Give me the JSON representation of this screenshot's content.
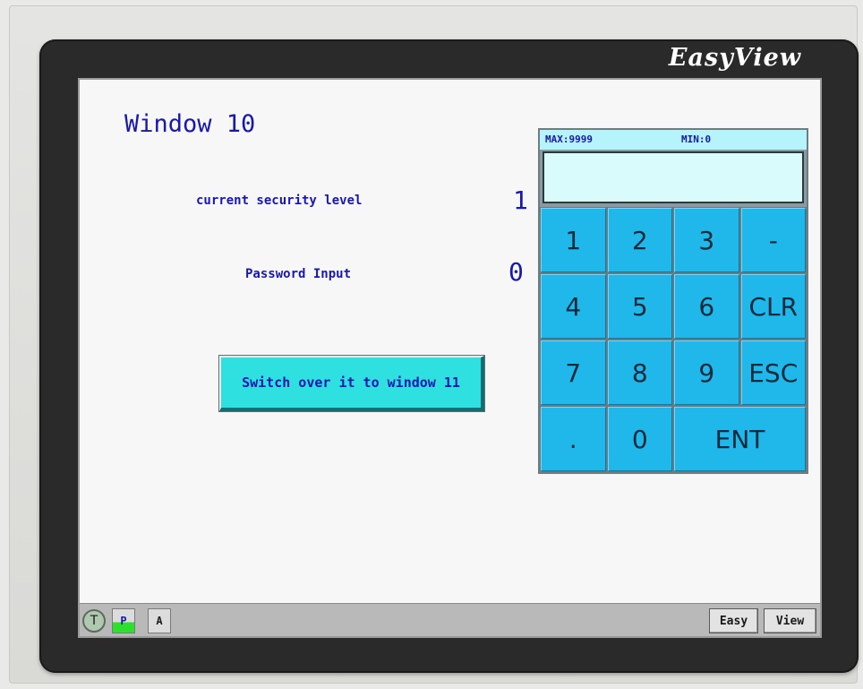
{
  "device": {
    "brand": "EasyView"
  },
  "screen": {
    "window_title": "Window 10",
    "security_label": "current security level",
    "security_value": "1",
    "password_label": "Password Input",
    "password_value": "0",
    "switch_button": "Switch over it to window 11"
  },
  "keypad": {
    "max_label": "MAX:9999",
    "min_label": "MIN:0",
    "display_value": "",
    "keys": [
      "1",
      "2",
      "3",
      "-",
      "4",
      "5",
      "6",
      "CLR",
      "7",
      "8",
      "9",
      "ESC",
      ".",
      "0",
      "ENT"
    ]
  },
  "statusbar": {
    "t_label": "T",
    "p_label": "P",
    "a_label": "A",
    "easy_label": "Easy",
    "view_label": "View"
  },
  "colors": {
    "text_blue": "#1818b0",
    "keypad_key": "#20b8ea",
    "switch_button": "#2ee0e0"
  }
}
